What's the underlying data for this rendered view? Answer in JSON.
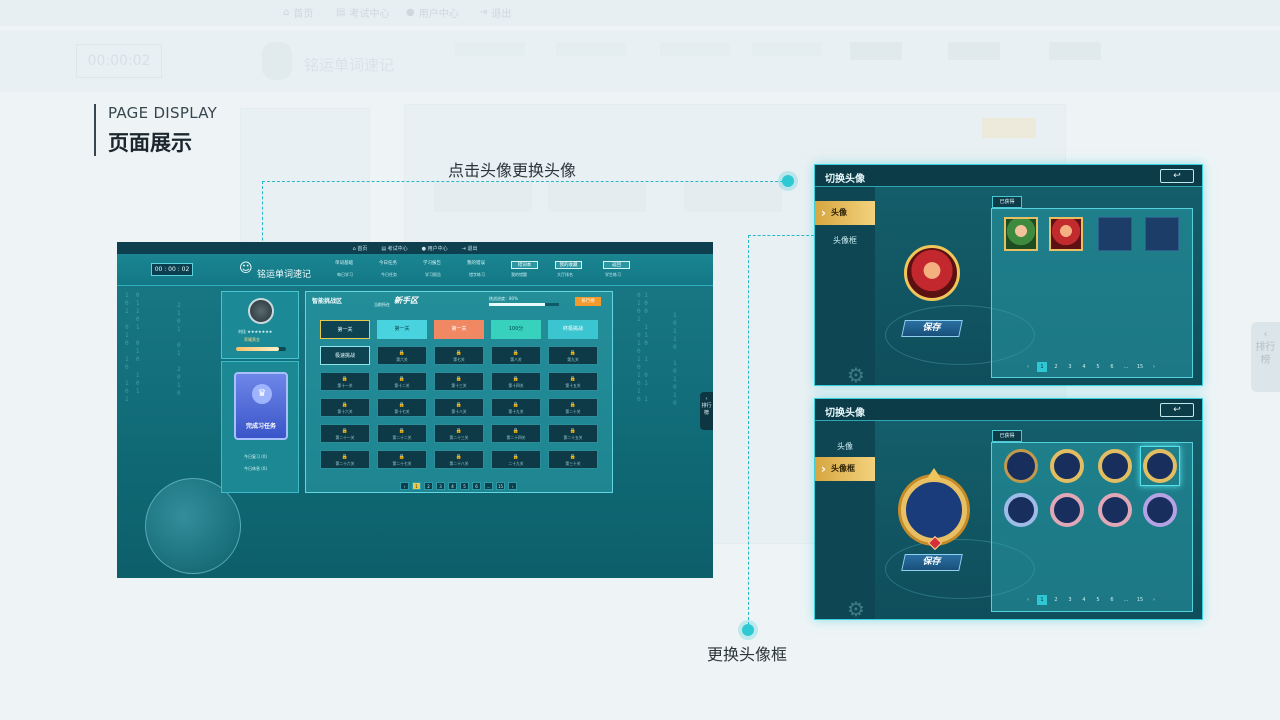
{
  "heading": {
    "en": "PAGE DISPLAY",
    "zh": "页面展示"
  },
  "annotations": {
    "top": "点击头像更换头像",
    "bottom": "更换头像框"
  },
  "background": {
    "nav": [
      "首页",
      "考试中心",
      "用户中心",
      "退出"
    ],
    "clock": "00:00:02",
    "app_title": "铭运单词速记",
    "side_tab": "排行榜"
  },
  "main": {
    "nav": [
      "首页",
      "考试中心",
      "用户中心",
      "退出"
    ],
    "clock": "00 : 00 : 02",
    "app_title": "铭运单词速记",
    "menu": [
      "单词基础",
      "今日任务",
      "学习报告",
      "我的错误"
    ],
    "menu_sub": [
      "每日学习",
      "今日任务",
      "学习报告",
      "错字练习"
    ],
    "pills": [
      "错词本",
      "我的收藏",
      "返回"
    ],
    "pill_sub": [
      "我的错题",
      "大厅排名",
      "学生练习"
    ],
    "profile": {
      "name": "刘佳 ★★★★★★★",
      "rank": "荣耀黄金",
      "exp_fraction": 0.85
    },
    "badge": "完成习任务",
    "stats": [
      "今日复习  (0)",
      "今日休息  (0)"
    ],
    "board": {
      "title": "智能挑战区",
      "zone": "新手区",
      "zone_prefix": "当前所在",
      "progress_label": "挑战进度：80%",
      "progress_fraction": 0.8,
      "button": "排行榜"
    },
    "levels": [
      [
        "第一关",
        "第一关",
        "第一关",
        "100分",
        "终极挑战"
      ],
      [
        "极速挑战",
        "第六关",
        "第七关",
        "第八关",
        "第九关"
      ],
      [
        "第十一关",
        "第十二关",
        "第十三关",
        "第十四关",
        "第十五关"
      ],
      [
        "第十六关",
        "第十七关",
        "第十八关",
        "第十九关",
        "第二十关"
      ],
      [
        "第二十一关",
        "第二十二关",
        "第二十三关",
        "第二十四关",
        "第二十五关"
      ],
      [
        "第二十六关",
        "第二十七关",
        "第二十八关",
        "二十九关",
        "第三十关"
      ]
    ],
    "pager": [
      "‹",
      "1",
      "2",
      "3",
      "4",
      "5",
      "6",
      "…",
      "15",
      "›"
    ],
    "side_tab": "排行榜"
  },
  "dialogs": {
    "title": "切换头像",
    "tabs": [
      "头像",
      "头像框"
    ],
    "save": "保存",
    "owned": "已获得",
    "pager": [
      "‹",
      "1",
      "2",
      "3",
      "4",
      "5",
      "6",
      "…",
      "15",
      "›"
    ]
  },
  "colors": {
    "accent": "#2fc9d4",
    "panel": "#155f6c",
    "gold": "#e8c063"
  }
}
